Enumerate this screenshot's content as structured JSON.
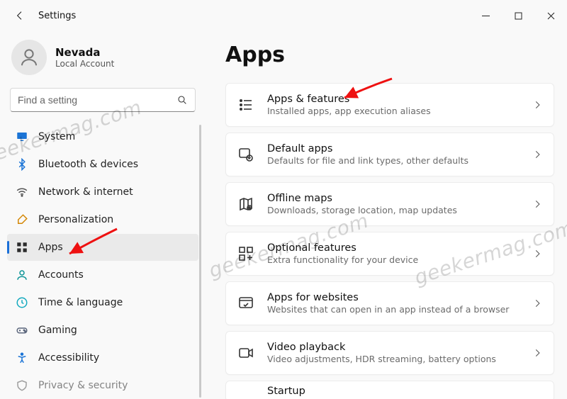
{
  "window": {
    "title": "Settings"
  },
  "user": {
    "name": "Nevada",
    "account_type": "Local Account"
  },
  "search": {
    "placeholder": "Find a setting"
  },
  "sidebar": {
    "items": [
      {
        "label": "System",
        "active": false
      },
      {
        "label": "Bluetooth & devices",
        "active": false
      },
      {
        "label": "Network & internet",
        "active": false
      },
      {
        "label": "Personalization",
        "active": false
      },
      {
        "label": "Apps",
        "active": true
      },
      {
        "label": "Accounts",
        "active": false
      },
      {
        "label": "Time & language",
        "active": false
      },
      {
        "label": "Gaming",
        "active": false
      },
      {
        "label": "Accessibility",
        "active": false
      },
      {
        "label": "Privacy & security",
        "active": false
      }
    ]
  },
  "page": {
    "title": "Apps"
  },
  "cards": [
    {
      "title": "Apps & features",
      "subtitle": "Installed apps, app execution aliases"
    },
    {
      "title": "Default apps",
      "subtitle": "Defaults for file and link types, other defaults"
    },
    {
      "title": "Offline maps",
      "subtitle": "Downloads, storage location, map updates"
    },
    {
      "title": "Optional features",
      "subtitle": "Extra functionality for your device"
    },
    {
      "title": "Apps for websites",
      "subtitle": "Websites that can open in an app instead of a browser"
    },
    {
      "title": "Video playback",
      "subtitle": "Video adjustments, HDR streaming, battery options"
    },
    {
      "title": "Startup",
      "subtitle": ""
    }
  ],
  "watermark": "geekermag.com"
}
